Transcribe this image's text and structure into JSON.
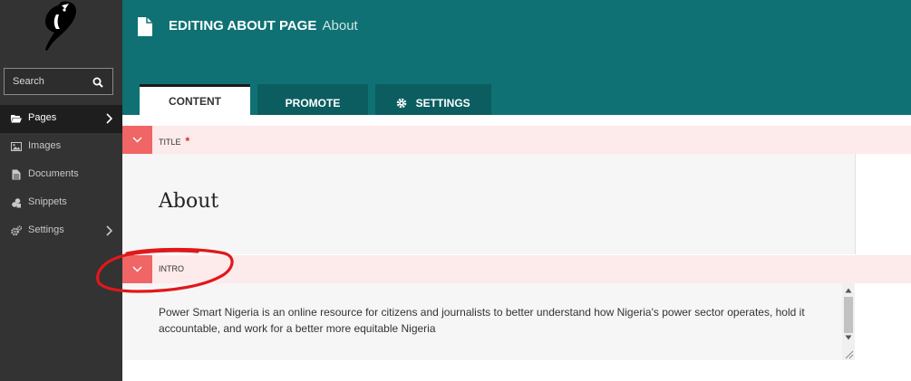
{
  "sidebar": {
    "search_placeholder": "Search",
    "items": [
      {
        "label": "Pages",
        "icon": "folder-open-icon",
        "active": true,
        "has_submenu": true
      },
      {
        "label": "Images",
        "icon": "image-icon",
        "active": false,
        "has_submenu": false
      },
      {
        "label": "Documents",
        "icon": "document-icon",
        "active": false,
        "has_submenu": false
      },
      {
        "label": "Snippets",
        "icon": "snippets-icon",
        "active": false,
        "has_submenu": false
      },
      {
        "label": "Settings",
        "icon": "cogs-icon",
        "active": false,
        "has_submenu": true
      }
    ]
  },
  "header": {
    "title": "EDITING ABOUT PAGE",
    "subtitle": "About",
    "background_color": "#0f7173"
  },
  "tabs": [
    {
      "label": "CONTENT",
      "active": true
    },
    {
      "label": "PROMOTE",
      "active": false
    },
    {
      "label": "SETTINGS",
      "active": false,
      "icon": "gear-icon"
    }
  ],
  "fields": {
    "title": {
      "label": "TITLE",
      "required_marker": "*",
      "value": "About"
    },
    "intro": {
      "label": "INTRO",
      "value": "Power Smart Nigeria is an online resource for citizens and journalists to better understand how Nigeria's power sector operates, hold it accountable, and work for a better more equitable Nigeria"
    }
  },
  "colors": {
    "field_header_bg": "#fdeaea",
    "toggle_bg": "#f06565",
    "annotation": "#e0181b"
  }
}
